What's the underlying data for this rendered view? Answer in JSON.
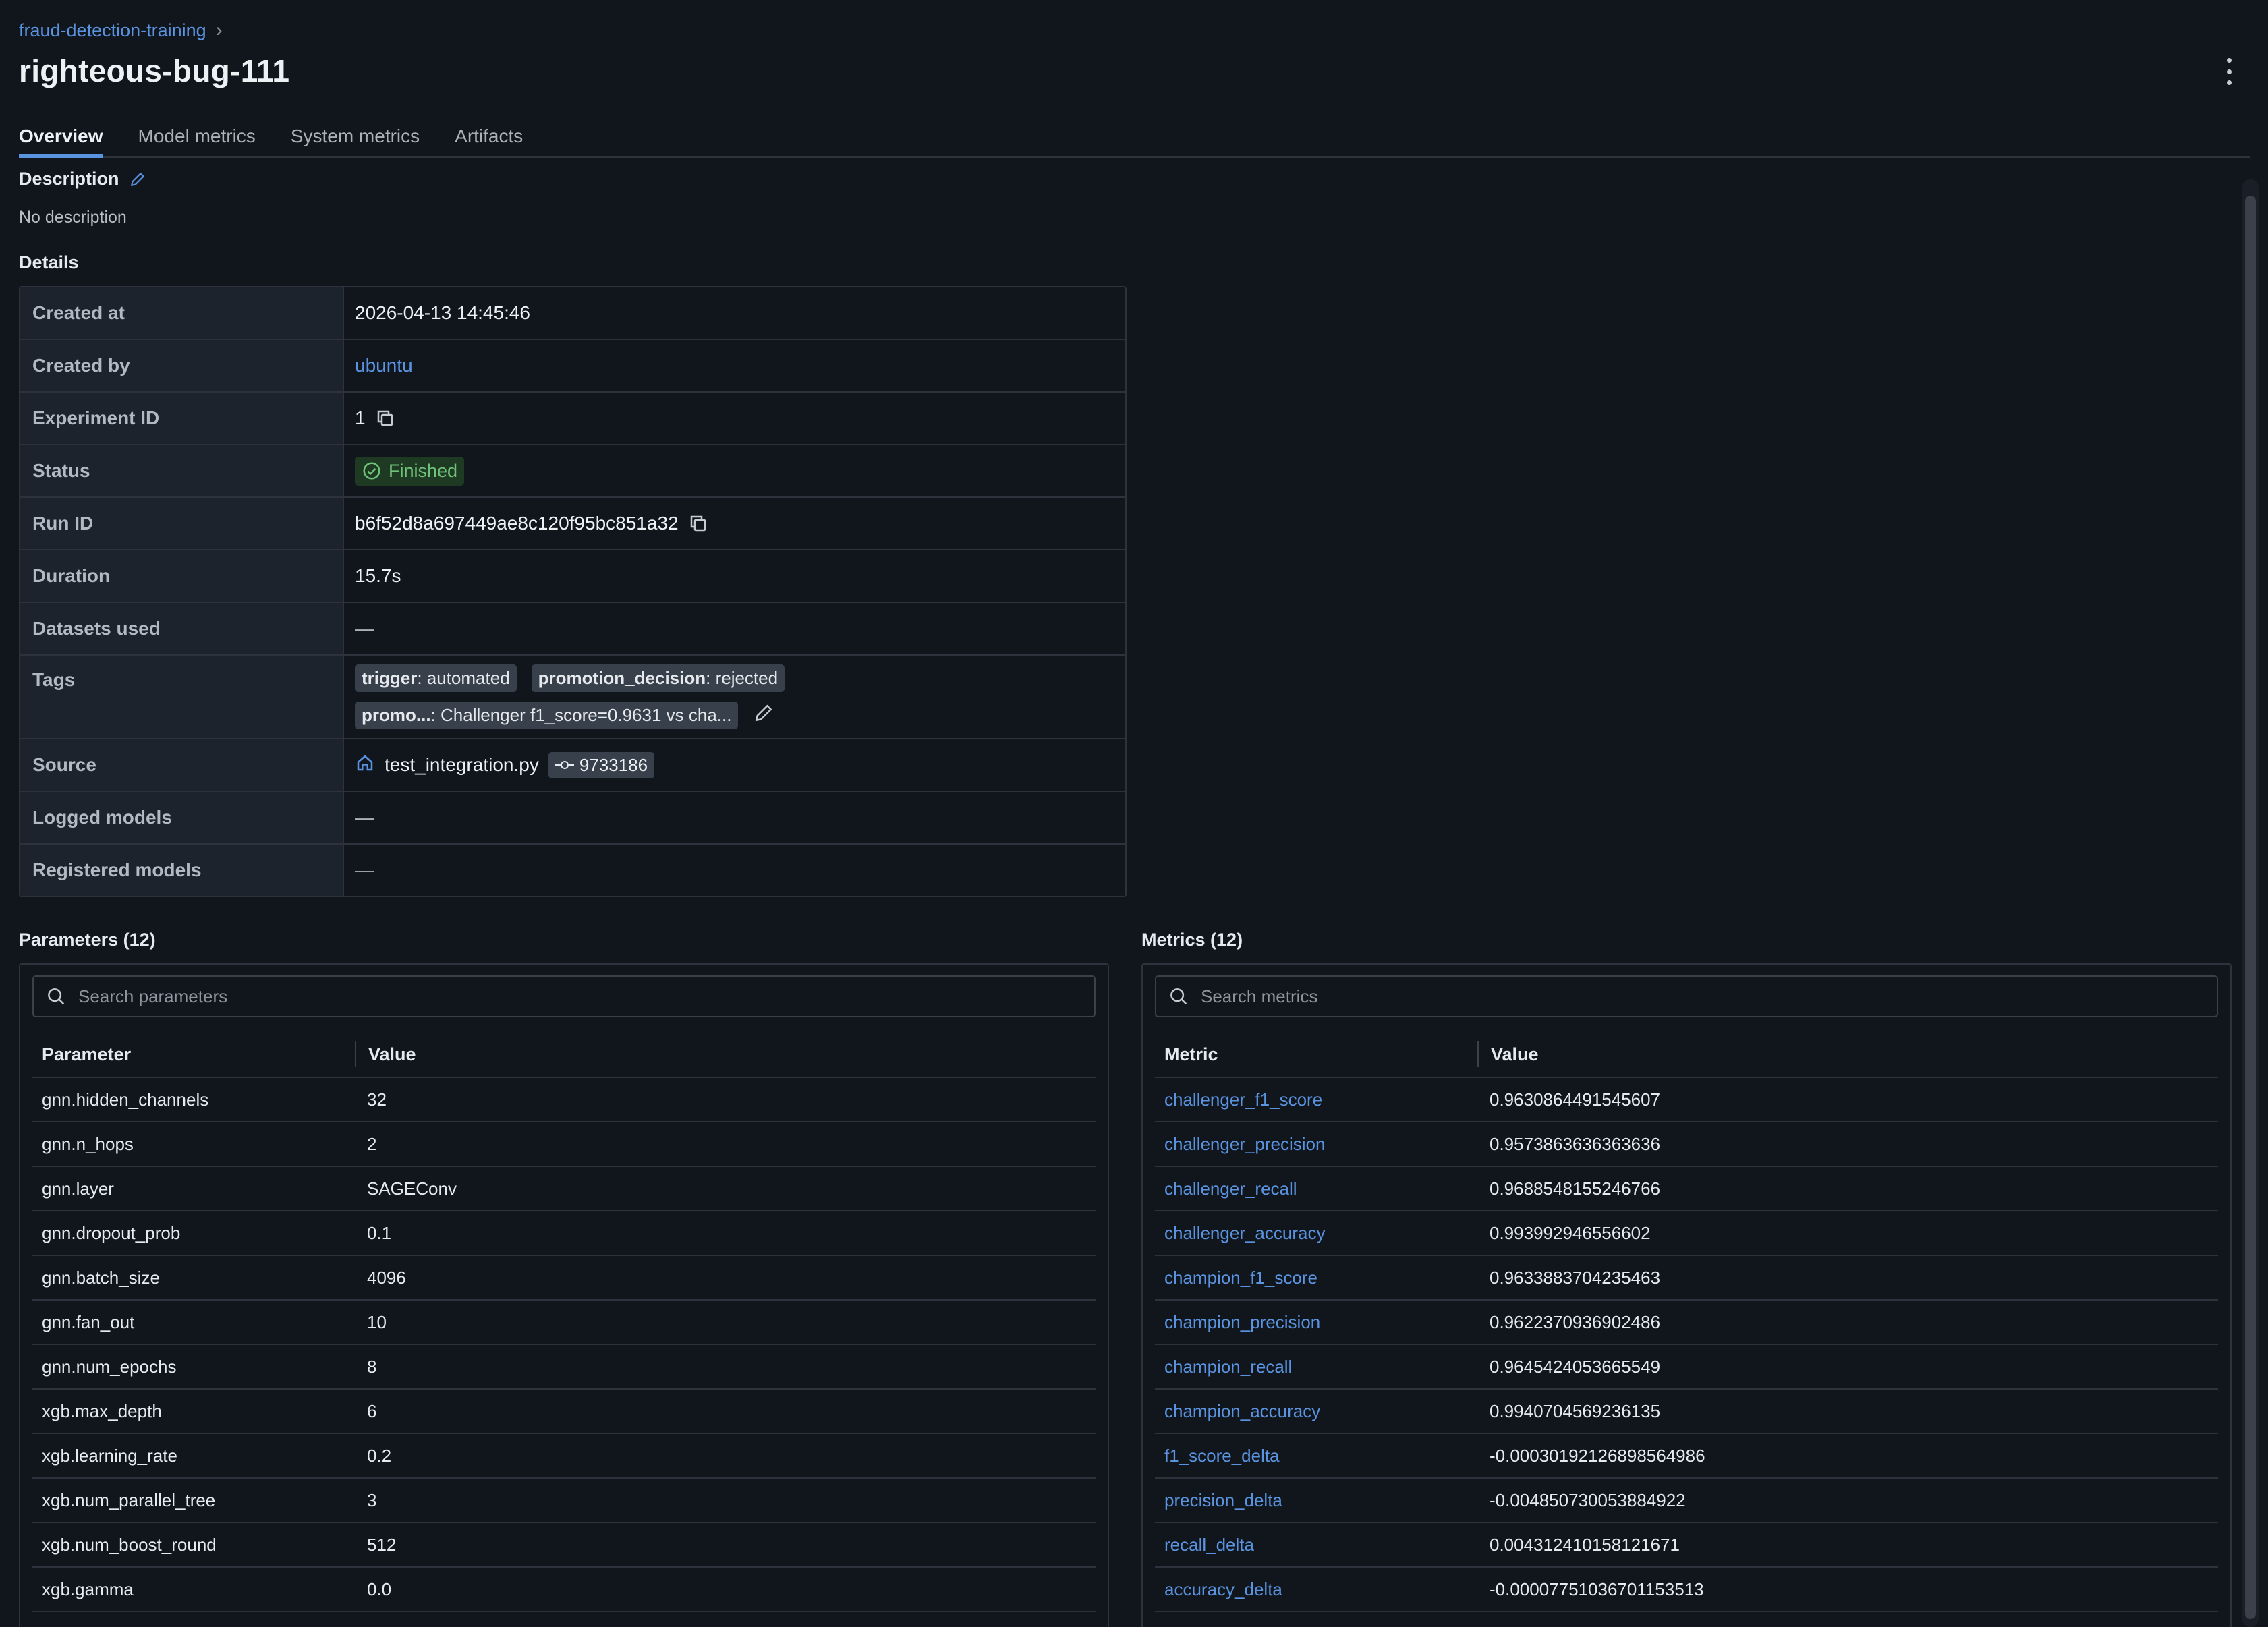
{
  "breadcrumb": {
    "experiment": "fraud-detection-training",
    "separator": "›"
  },
  "run_title": "righteous-bug-111",
  "tabs": [
    {
      "label": "Overview"
    },
    {
      "label": "Model metrics"
    },
    {
      "label": "System metrics"
    },
    {
      "label": "Artifacts"
    }
  ],
  "description": {
    "title": "Description",
    "text": "No description"
  },
  "details": {
    "title": "Details",
    "created_at_label": "Created at",
    "created_at": "2026-04-13 14:45:46",
    "created_by_label": "Created by",
    "created_by": "ubuntu",
    "experiment_id_label": "Experiment ID",
    "experiment_id": "1",
    "status_label": "Status",
    "status": "Finished",
    "run_id_label": "Run ID",
    "run_id": "b6f52d8a697449ae8c120f95bc851a32",
    "duration_label": "Duration",
    "duration": "15.7s",
    "datasets_label": "Datasets used",
    "datasets": "—",
    "tags_label": "Tags",
    "tags": [
      {
        "key": "trigger",
        "value": ": automated"
      },
      {
        "key": "promotion_decision",
        "value": ": rejected"
      },
      {
        "key": "promo...",
        "value": ": Challenger f1_score=0.9631 vs cha..."
      }
    ],
    "source_label": "Source",
    "source_file": "test_integration.py",
    "source_commit": "9733186",
    "logged_models_label": "Logged models",
    "logged_models": "—",
    "registered_models_label": "Registered models",
    "registered_models": "—"
  },
  "parameters": {
    "title": "Parameters (12)",
    "search_placeholder": "Search parameters",
    "col_name": "Parameter",
    "col_value": "Value",
    "rows": [
      {
        "name": "gnn.hidden_channels",
        "value": "32"
      },
      {
        "name": "gnn.n_hops",
        "value": "2"
      },
      {
        "name": "gnn.layer",
        "value": "SAGEConv"
      },
      {
        "name": "gnn.dropout_prob",
        "value": "0.1"
      },
      {
        "name": "gnn.batch_size",
        "value": "4096"
      },
      {
        "name": "gnn.fan_out",
        "value": "10"
      },
      {
        "name": "gnn.num_epochs",
        "value": "8"
      },
      {
        "name": "xgb.max_depth",
        "value": "6"
      },
      {
        "name": "xgb.learning_rate",
        "value": "0.2"
      },
      {
        "name": "xgb.num_parallel_tree",
        "value": "3"
      },
      {
        "name": "xgb.num_boost_round",
        "value": "512"
      },
      {
        "name": "xgb.gamma",
        "value": "0.0"
      }
    ]
  },
  "metrics": {
    "title": "Metrics (12)",
    "search_placeholder": "Search metrics",
    "col_name": "Metric",
    "col_value": "Value",
    "rows": [
      {
        "name": "challenger_f1_score",
        "value": "0.9630864491545607"
      },
      {
        "name": "challenger_precision",
        "value": "0.9573863636363636"
      },
      {
        "name": "challenger_recall",
        "value": "0.9688548155246766"
      },
      {
        "name": "challenger_accuracy",
        "value": "0.993992946556602"
      },
      {
        "name": "champion_f1_score",
        "value": "0.9633883704235463"
      },
      {
        "name": "champion_precision",
        "value": "0.9622370936902486"
      },
      {
        "name": "champion_recall",
        "value": "0.9645424053665549"
      },
      {
        "name": "champion_accuracy",
        "value": "0.9940704569236135"
      },
      {
        "name": "f1_score_delta",
        "value": "-0.00030192126898564986"
      },
      {
        "name": "precision_delta",
        "value": "-0.004850730053884922"
      },
      {
        "name": "recall_delta",
        "value": "0.004312410158121671"
      },
      {
        "name": "accuracy_delta",
        "value": "-0.00007751036701153513"
      }
    ]
  },
  "colors": {
    "accent": "#5a93e0",
    "success": "#6fc27a",
    "background": "#11161d"
  }
}
